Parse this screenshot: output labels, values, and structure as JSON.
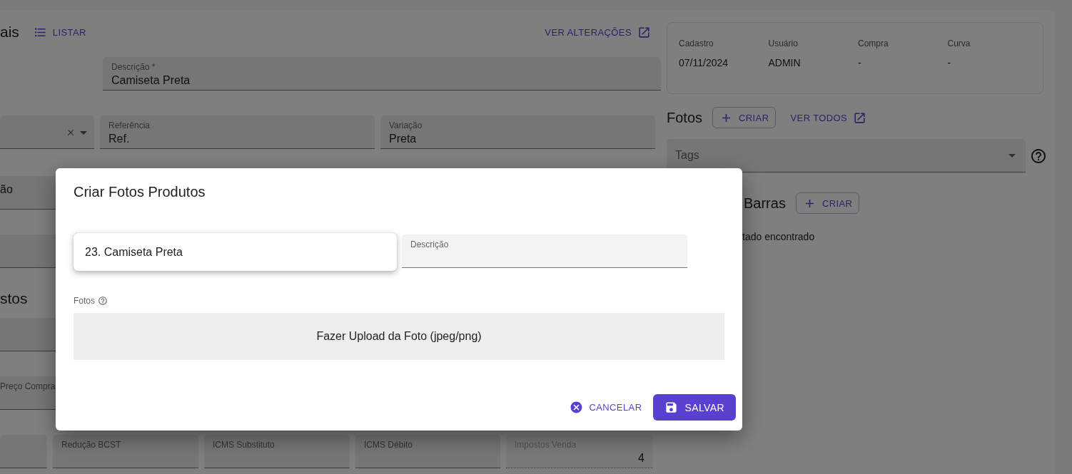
{
  "page": {
    "title": "ais",
    "list_button": "LISTAR",
    "changes_link": "VER ALTERAÇÕES",
    "rows": [
      {
        "kind": "fields",
        "fields": [
          {
            "kind": "text",
            "label": "Descrição *",
            "value": "Camiseta Preta"
          }
        ]
      },
      {
        "kind": "fields",
        "fields": [
          {
            "kind": "select"
          },
          {
            "kind": "text",
            "label": "Referência",
            "value": "Ref."
          },
          {
            "kind": "text",
            "label": "Variação",
            "value": "Preta"
          }
        ]
      },
      {
        "kind": "fields",
        "fields": [
          {
            "kind": "text",
            "value": "ão"
          }
        ]
      },
      {
        "kind": "fields",
        "fields": [
          {
            "kind": "text"
          }
        ]
      },
      {
        "kind": "heading",
        "text": "stos"
      },
      {
        "kind": "fields",
        "fields": [
          {
            "kind": "text"
          }
        ]
      },
      {
        "kind": "fields",
        "fields": [
          {
            "kind": "text",
            "label": "Preço Compra"
          }
        ]
      },
      {
        "kind": "fields",
        "fields": [
          {
            "kind": "text",
            "disabled": false
          },
          {
            "kind": "text",
            "label": "Redução BCST",
            "disabled": false
          },
          {
            "kind": "text",
            "label": "ICMS Substituto",
            "disabled": false
          },
          {
            "kind": "text",
            "label": "ICMS Débito",
            "disabled": false
          },
          {
            "kind": "text",
            "label": "Impostos Venda",
            "value": "4",
            "disabled": true
          }
        ]
      }
    ]
  },
  "side": {
    "info": [
      {
        "label": "Cadastro",
        "value": "07/11/2024"
      },
      {
        "label": "Usuário",
        "value": "ADMIN"
      },
      {
        "label": "Compra",
        "value": "-"
      },
      {
        "label": "Curva",
        "value": "-"
      }
    ],
    "photos": {
      "title": "Fotos",
      "create": "CRIAR",
      "view_all": "VER TODOS"
    },
    "tags": {
      "placeholder": "Tags"
    },
    "barcodes": {
      "title": "Barras",
      "create": "CRIAR",
      "empty": "tado encontrado"
    }
  },
  "dialog": {
    "title": "Criar Fotos Produtos",
    "option": "23. Camiseta Preta",
    "description_label": "Descrição",
    "photos_label": "Fotos",
    "upload": "Fazer Upload da Foto (jpeg/png)",
    "cancel": "CANCELAR",
    "save": "SALVAR"
  }
}
